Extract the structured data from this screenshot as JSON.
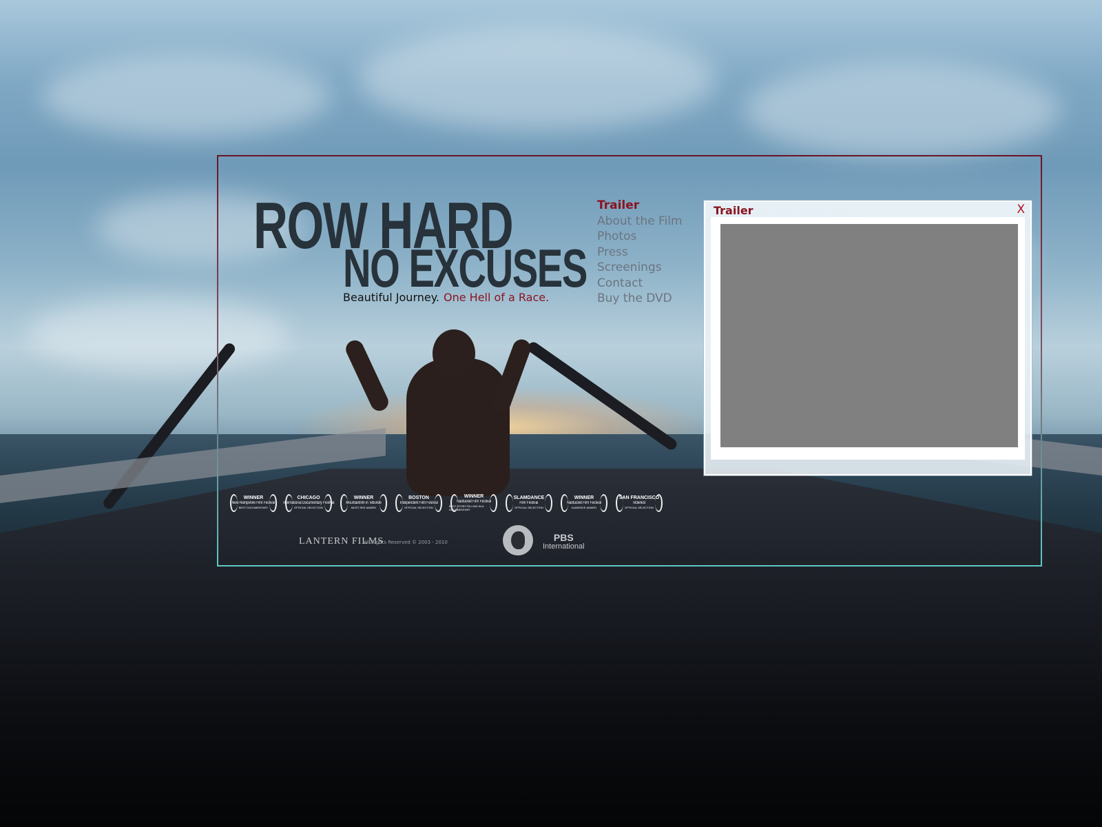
{
  "title": {
    "line1": "ROW HARD",
    "line2": "NO EXCUSES",
    "tagline_a": "Beautiful Journey.",
    "tagline_b": "One Hell of a Race."
  },
  "nav": {
    "items": [
      {
        "label": "Trailer",
        "active": true
      },
      {
        "label": "About the Film",
        "active": false
      },
      {
        "label": "Photos",
        "active": false
      },
      {
        "label": "Press",
        "active": false
      },
      {
        "label": "Screenings",
        "active": false
      },
      {
        "label": "Contact",
        "active": false
      },
      {
        "label": "Buy the DVD",
        "active": false
      }
    ]
  },
  "laurels": [
    {
      "l1": "WINNER",
      "l2": "New Hampshire Film Festival",
      "l3": "BEST DOCUMENTARY"
    },
    {
      "l1": "CHICAGO",
      "l2": "International Documentary Festival",
      "l3": "OFFICIAL SELECTION"
    },
    {
      "l1": "WINNER",
      "l2": "Mountainfilm in Telluride",
      "l3": "MOST-SEE AWARD"
    },
    {
      "l1": "BOSTON",
      "l2": "Independent Film Festival",
      "l3": "OFFICIAL SELECTION"
    },
    {
      "l1": "WINNER",
      "l2": "Nantucket Film Festival",
      "l3": "BEST STORYTELLING IN A DOCUMENTARY"
    },
    {
      "l1": "SLAMDANCE",
      "l2": "Film Festival",
      "l3": "OFFICIAL SELECTION"
    },
    {
      "l1": "WINNER",
      "l2": "Nantucket Film Festival",
      "l3": "AUDIENCE AWARD"
    },
    {
      "l1": "SAN FRANCISCO",
      "l2": "Indiefest",
      "l3": "OFFICIAL SELECTION"
    }
  ],
  "footer": {
    "studio": "LANTERN FILMS",
    "rights": "All Rights Reserved © 2003 - 2010",
    "pbs_line1": "PBS",
    "pbs_line2": "International"
  },
  "modal": {
    "title": "Trailer",
    "close_label": "X"
  },
  "colors": {
    "accent": "#8a1420",
    "nav_inactive": "#6b7480",
    "title": "#27323b",
    "video_placeholder": "#808080"
  }
}
